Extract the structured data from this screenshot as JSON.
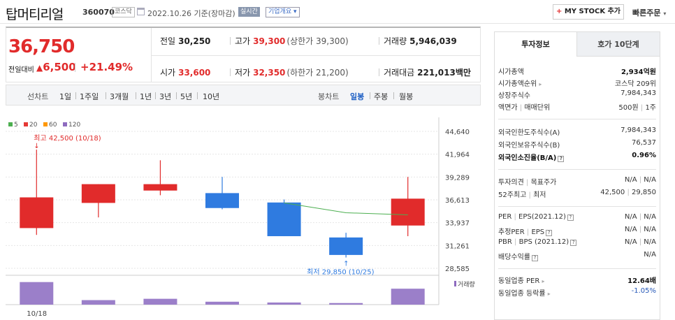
{
  "header": {
    "name": "탑머티리얼",
    "code": "360070",
    "market": "코스닥",
    "date": "2022.10.26 기준(장마감)",
    "realtime": "실시간",
    "overview": "기업개요",
    "mystock": "MY STOCK 추가",
    "quick_order": "빠른주문"
  },
  "price": {
    "current": "36,750",
    "change_label": "전일대비",
    "change": "6,500",
    "rate": "+21.49%"
  },
  "stats": {
    "prev": {
      "k": "전일",
      "v": "30,250"
    },
    "high": {
      "k": "고가",
      "v": "39,300",
      "sub": "(상한가 39,300)"
    },
    "volume": {
      "k": "거래량",
      "v": "5,946,039"
    },
    "open": {
      "k": "시가",
      "v": "33,600"
    },
    "low": {
      "k": "저가",
      "v": "32,350",
      "sub": "(하한가 21,200)"
    },
    "amount": {
      "k": "거래대금",
      "v": "221,013",
      "unit": "백만"
    }
  },
  "period": {
    "label_line": "선차트",
    "line_opts": [
      "1일",
      "1주일",
      "3개월",
      "1년",
      "3년",
      "5년",
      "10년"
    ],
    "label_candle": "봉차트",
    "candle_opts": [
      "일봉",
      "주봉",
      "월봉"
    ],
    "candle_active": "일봉"
  },
  "chart_data": {
    "type": "candlestick",
    "legend": [
      "5",
      "20",
      "60",
      "120"
    ],
    "legend_colors": [
      "#4caf50",
      "#e53935",
      "#ff9800",
      "#8e6bbf"
    ],
    "yticks": [
      "44,640",
      "41,964",
      "39,289",
      "36,613",
      "33,937",
      "31,261",
      "28,585"
    ],
    "ytick_values": [
      44640,
      41964,
      39289,
      36613,
      33937,
      31261,
      28585
    ],
    "ylim": [
      28585,
      44640
    ],
    "candles": [
      {
        "open": 33300,
        "close": 36900,
        "high": 42500,
        "low": 32500
      },
      {
        "open": 36250,
        "close": 38450,
        "high": 38450,
        "low": 34550
      },
      {
        "open": 37700,
        "close": 38450,
        "high": 41250,
        "low": 37150
      },
      {
        "open": 37400,
        "close": 35650,
        "high": 39300,
        "low": 35500
      },
      {
        "open": 36300,
        "close": 32350,
        "high": 36650,
        "low": 32350
      },
      {
        "open": 32200,
        "close": 30150,
        "high": 32750,
        "low": 29850
      },
      {
        "open": 33600,
        "close": 36750,
        "high": 39300,
        "low": 32350
      }
    ],
    "ma5": [
      null,
      null,
      null,
      null,
      36250,
      35100,
      34850
    ],
    "volumes": [
      0.85,
      0.17,
      0.22,
      0.11,
      0.08,
      0.06,
      0.6
    ],
    "high_label": "최고 42,500 (10/18)",
    "low_label": "최저 29,850 (10/25)",
    "volume_label": "거래량",
    "x_label": "10/18"
  },
  "panel": {
    "tab_on": "투자정보",
    "tab_off": "호가 10단계",
    "rows1": [
      {
        "k": "시가총액",
        "v": "2,934억원"
      },
      {
        "k": "시가총액순위",
        "v": "코스닥 209위"
      },
      {
        "k": "상장주식수",
        "v": "7,984,343"
      },
      {
        "k": "액면가",
        "k2": "매매단위",
        "v": "500원",
        "v2": "1주"
      }
    ],
    "rows2": [
      {
        "k": "외국인한도주식수(A)",
        "v": "7,984,343"
      },
      {
        "k": "외국인보유주식수(B)",
        "v": "76,537"
      },
      {
        "k": "외국인소진율(B/A)",
        "v": "0.96%"
      }
    ],
    "rows3": [
      {
        "k": "투자의견",
        "k2": "목표주가",
        "v": "N/A",
        "v2": "N/A"
      },
      {
        "k": "52주최고",
        "k2": "최저",
        "v": "42,500",
        "v2": "29,850"
      }
    ],
    "rows4": [
      {
        "k": "PER",
        "k2": "EPS(2021.12)",
        "v": "N/A",
        "v2": "N/A"
      },
      {
        "k": "추정PER",
        "k2": "EPS",
        "v": "N/A",
        "v2": "N/A"
      },
      {
        "k": "PBR",
        "k2": "BPS (2021.12)",
        "v": "N/A",
        "v2": "N/A"
      },
      {
        "k": "배당수익률",
        "v": "N/A"
      }
    ],
    "rows5": [
      {
        "k": "동일업종 PER",
        "v": "12.64배"
      },
      {
        "k": "동일업종 등락률",
        "v": "-1.05%"
      }
    ]
  }
}
